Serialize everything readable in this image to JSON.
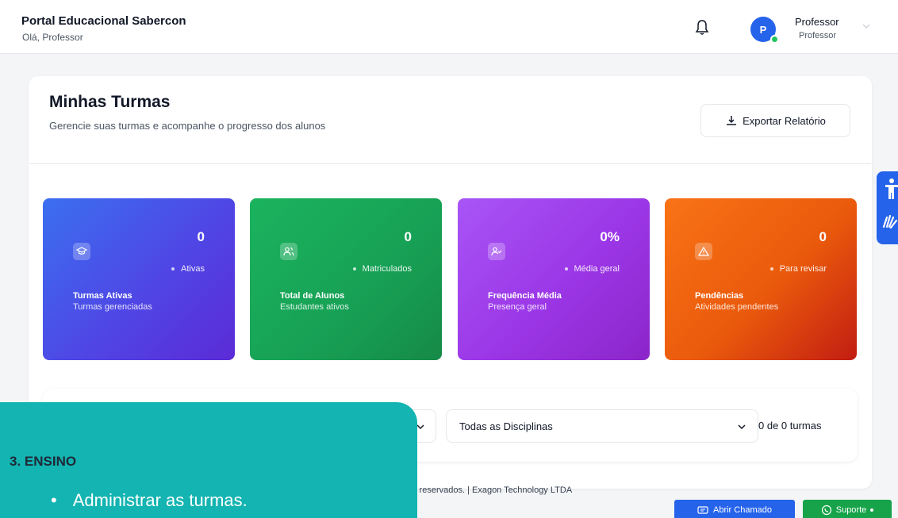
{
  "header": {
    "portal_title": "Portal Educacional Sabercon",
    "greeting": "Olá, Professor",
    "avatar_initial": "P",
    "user_name": "Professor",
    "user_role": "Professor"
  },
  "page": {
    "title": "Minhas Turmas",
    "subtitle": "Gerencie suas turmas e acompanhe o progresso dos alunos",
    "export_label": "Exportar Relatório"
  },
  "stats": [
    {
      "value": "0",
      "badge": "Ativas",
      "label": "Turmas Ativas",
      "desc": "Turmas gerenciadas",
      "icon": "graduation-cap-icon"
    },
    {
      "value": "0",
      "badge": "Matriculados",
      "label": "Total de Alunos",
      "desc": "Estudantes ativos",
      "icon": "users-icon"
    },
    {
      "value": "0%",
      "badge": "Média geral",
      "label": "Frequência Média",
      "desc": "Presença geral",
      "icon": "user-check-icon"
    },
    {
      "value": "0",
      "badge": "Para revisar",
      "label": "Pendências",
      "desc": "Atividades pendentes",
      "icon": "warning-icon"
    }
  ],
  "filters": {
    "discipline_select": "Todas as Disciplinas",
    "count_text": "0 de 0 turmas"
  },
  "footer": {
    "copyright_text": "s reservados. | Exagon Technology LTDA",
    "abrir_chamado": "Abrir Chamado",
    "suporte": "Suporte"
  },
  "overlay": {
    "heading": "3.  ENSINO",
    "bullet": "•",
    "item": "Administrar as turmas."
  },
  "colors": {
    "brand_blue": "#2563eb",
    "card_blue": "#4f46e5",
    "card_green": "#17a055",
    "card_purple": "#9b36e6",
    "card_orange": "#ea5a0c",
    "overlay_teal": "#13b4b1",
    "support_green": "#16a34a"
  }
}
